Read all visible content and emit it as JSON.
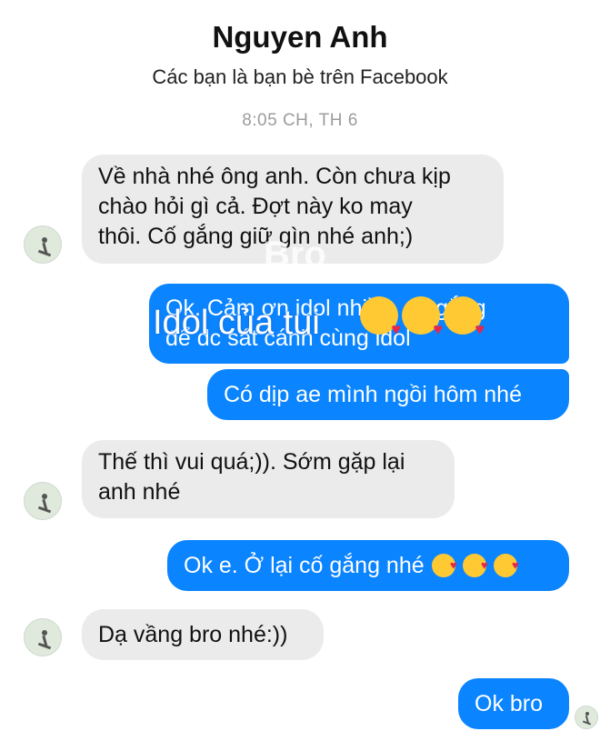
{
  "header": {
    "contact_name": "Nguyen Anh",
    "subtitle": "Các bạn là bạn bè trên Facebook"
  },
  "timestamp": "8:05 CH, TH 6",
  "messages": [
    {
      "from": "them",
      "text": "Về nhà nhé ông anh. Còn chưa kịp\nchào hỏi gì cả. Đợt này ko may\nthôi. Cố gắng giữ gìn nhé anh;)"
    },
    {
      "from": "me",
      "text": "Ok. Cảm ơn idol nhiều, cố gắng\nđể dc sát cánh cùng idol"
    },
    {
      "from": "me",
      "text": "Có dịp ae mình ngồi hôm nhé"
    },
    {
      "from": "them",
      "text": "Thế thì vui quá;)). Sớm gặp lại\nanh nhé"
    },
    {
      "from": "me",
      "text": "Ok e. Ở lại cố gắng nhé",
      "emoji": [
        "kissing-heart-emoji",
        "kissing-heart-emoji",
        "kissing-heart-emoji"
      ]
    },
    {
      "from": "them",
      "text": "Dạ vầng bro nhé:))"
    },
    {
      "from": "me",
      "text": "Ok bro"
    }
  ],
  "overlay": {
    "text": "Idol của tui",
    "watermark": "Bro",
    "emoji": [
      "kissing-heart-emoji",
      "kissing-heart-emoji",
      "kissing-heart-emoji"
    ]
  },
  "colors": {
    "outgoing_bubble": "#0a84ff",
    "incoming_bubble": "#ebebeb",
    "timestamp": "#9c9c9c",
    "emoji_face": "#ffc933",
    "emoji_heart": "#e8264b"
  }
}
